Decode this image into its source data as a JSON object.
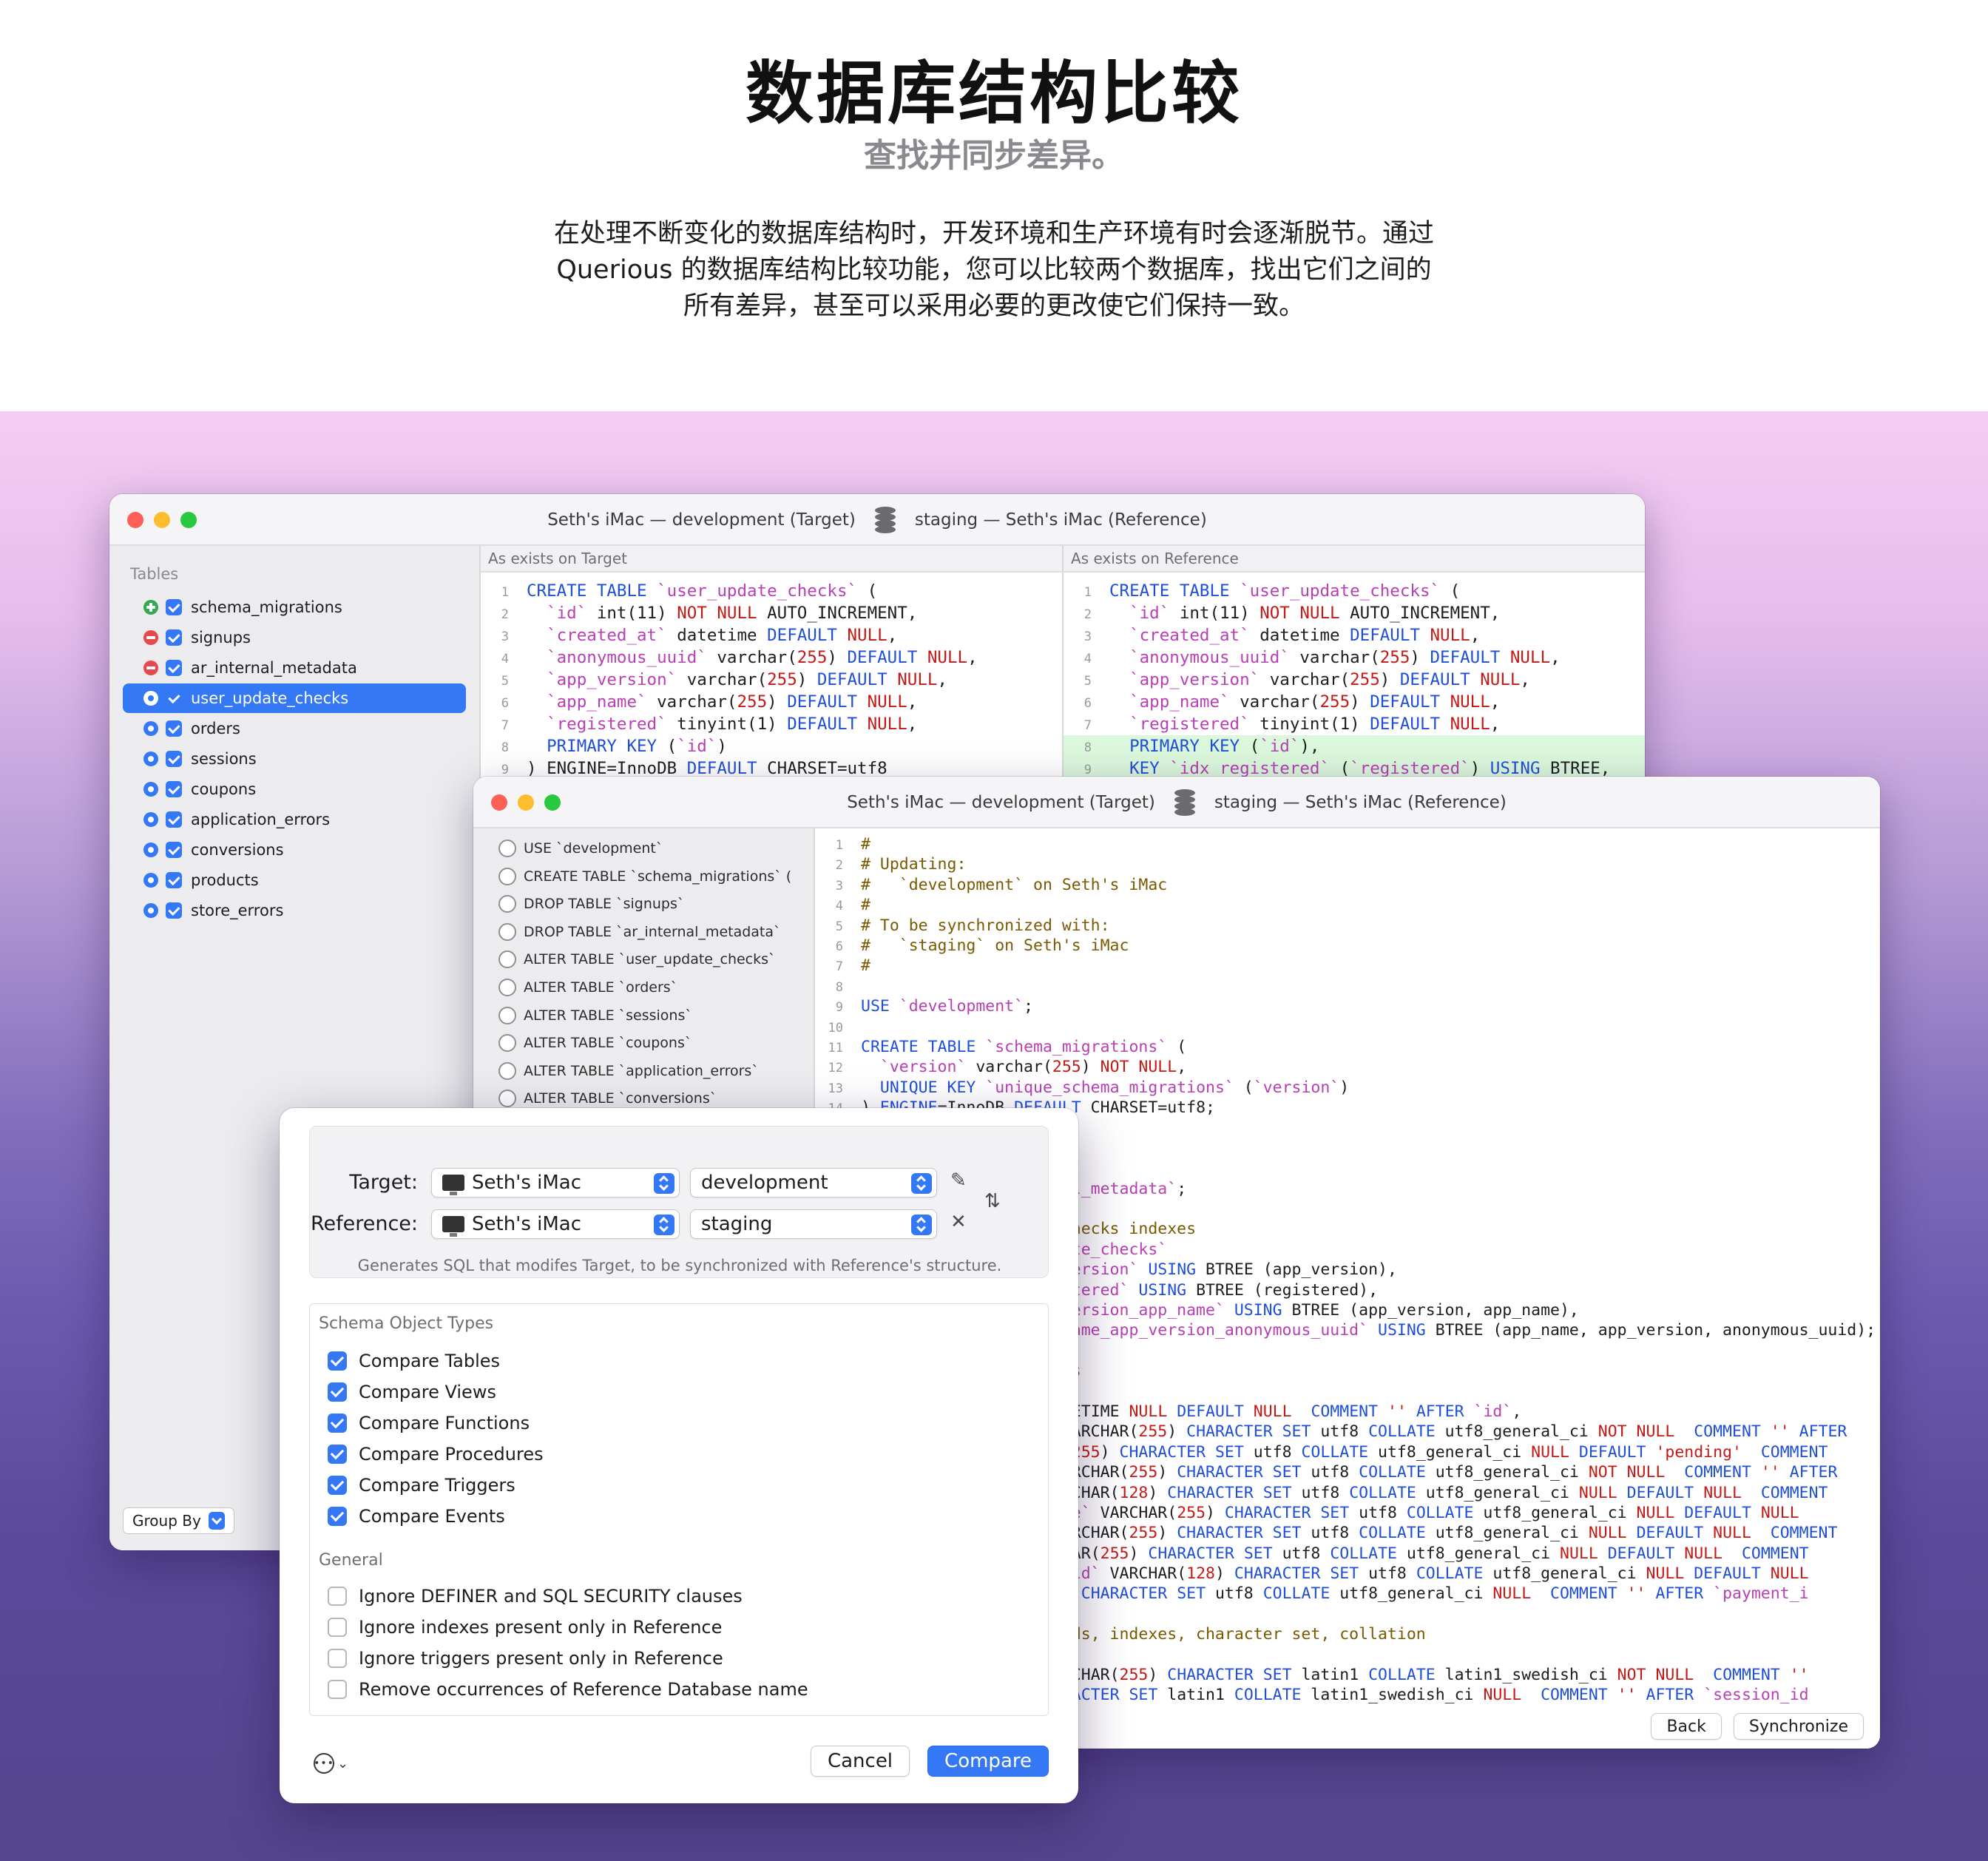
{
  "hero": {
    "title": "数据库结构比较",
    "subtitle": "查找并同步差异。",
    "desc_lines": [
      "在处理不断变化的数据库结构时，开发环境和生产环境有时会逐渐脱节。通过",
      "Querious 的数据库结构比较功能，您可以比较两个数据库，找出它们之间的",
      "所有差异，甚至可以采用必要的更改使它们保持一致。"
    ]
  },
  "window": {
    "target_label": "Seth's iMac — development (Target)",
    "reference_label": "staging — Seth's iMac (Reference)"
  },
  "sidebar": {
    "heading": "Tables",
    "items": [
      {
        "name": "schema_migrations",
        "status": "added"
      },
      {
        "name": "signups",
        "status": "removed"
      },
      {
        "name": "ar_internal_metadata",
        "status": "removed"
      },
      {
        "name": "user_update_checks",
        "status": "modified",
        "selected": true
      },
      {
        "name": "orders",
        "status": "modified"
      },
      {
        "name": "sessions",
        "status": "modified"
      },
      {
        "name": "coupons",
        "status": "modified"
      },
      {
        "name": "application_errors",
        "status": "modified"
      },
      {
        "name": "conversions",
        "status": "modified"
      },
      {
        "name": "products",
        "status": "modified"
      },
      {
        "name": "store_errors",
        "status": "modified"
      }
    ],
    "group_by_label": "Group By"
  },
  "diff": {
    "left_header": "As exists on Target",
    "right_header": "As exists on Reference"
  },
  "statements": [
    "USE `development`",
    "CREATE TABLE `schema_migrations` (",
    "DROP TABLE `signups`",
    "DROP TABLE `ar_internal_metadata`",
    "ALTER TABLE `user_update_checks`",
    "ALTER TABLE `orders`",
    "ALTER TABLE `sessions`",
    "ALTER TABLE `coupons`",
    "ALTER TABLE `application_errors`",
    "ALTER TABLE `conversions`"
  ],
  "sync": {
    "back_label": "Back",
    "synchronize_label": "Synchronize"
  },
  "sheet": {
    "target_label": "Target:",
    "reference_label": "Reference:",
    "target_server": "Seth's iMac",
    "target_db": "development",
    "reference_server": "Seth's iMac",
    "reference_db": "staging",
    "hint": "Generates SQL that modifes Target, to be synchronized with Reference's structure.",
    "schema_heading": "Schema Object Types",
    "schema_options": [
      {
        "label": "Compare Tables",
        "checked": true
      },
      {
        "label": "Compare Views",
        "checked": true
      },
      {
        "label": "Compare Functions",
        "checked": true
      },
      {
        "label": "Compare Procedures",
        "checked": true
      },
      {
        "label": "Compare Triggers",
        "checked": true
      },
      {
        "label": "Compare Events",
        "checked": true
      }
    ],
    "general_heading": "General",
    "general_options": [
      {
        "label": "Ignore DEFINER and SQL SECURITY clauses",
        "checked": false
      },
      {
        "label": "Ignore indexes present only in Reference",
        "checked": false
      },
      {
        "label": "Ignore triggers present only in Reference",
        "checked": false
      },
      {
        "label": "Remove occurrences of Reference Database name",
        "checked": false
      }
    ],
    "cancel_label": "Cancel",
    "compare_label": "Compare"
  },
  "icons": {
    "database": "database-icon",
    "pencil": "pencil-icon",
    "swap": "swap-arrows-icon",
    "wand": "wand-icon",
    "more": "ellipsis-circle-icon"
  },
  "colors": {
    "accent": "#3478f6",
    "added": "#34a853",
    "removed": "#e5484d",
    "diff_highlight": "#dbf8dc"
  }
}
